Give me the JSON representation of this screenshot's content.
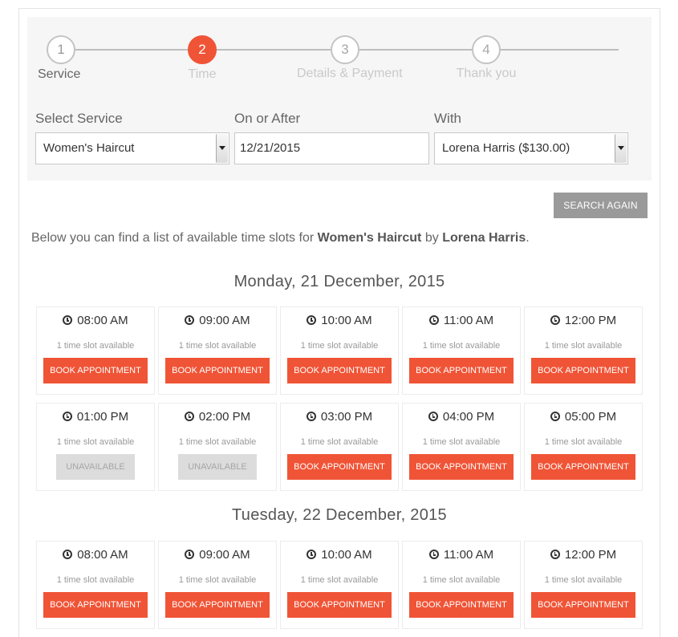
{
  "steps": [
    {
      "number": "1",
      "label": "Service"
    },
    {
      "number": "2",
      "label": "Time"
    },
    {
      "number": "3",
      "label": "Details & Payment"
    },
    {
      "number": "4",
      "label": "Thank you"
    }
  ],
  "form": {
    "service_label": "Select Service",
    "service_value": "Women's Haircut",
    "date_label": "On or After",
    "date_value": "12/21/2015",
    "staff_label": "With",
    "staff_value": "Lorena Harris ($130.00)"
  },
  "search_again_label": "SEARCH AGAIN",
  "intro": {
    "prefix": "Below you can find a list of available time slots for ",
    "service": "Women's Haircut",
    "middle": " by ",
    "staff": "Lorena Harris",
    "suffix": "."
  },
  "days": [
    {
      "heading": "Monday, 21 December, 2015",
      "slots": [
        {
          "time": "08:00 AM",
          "availability": "1 time slot available",
          "button": "BOOK APPOINTMENT",
          "available": true
        },
        {
          "time": "09:00 AM",
          "availability": "1 time slot available",
          "button": "BOOK APPOINTMENT",
          "available": true
        },
        {
          "time": "10:00 AM",
          "availability": "1 time slot available",
          "button": "BOOK APPOINTMENT",
          "available": true
        },
        {
          "time": "11:00 AM",
          "availability": "1 time slot available",
          "button": "BOOK APPOINTMENT",
          "available": true
        },
        {
          "time": "12:00 PM",
          "availability": "1 time slot available",
          "button": "BOOK APPOINTMENT",
          "available": true
        },
        {
          "time": "01:00 PM",
          "availability": "1 time slot available",
          "button": "UNAVAILABLE",
          "available": false
        },
        {
          "time": "02:00 PM",
          "availability": "1 time slot available",
          "button": "UNAVAILABLE",
          "available": false
        },
        {
          "time": "03:00 PM",
          "availability": "1 time slot available",
          "button": "BOOK APPOINTMENT",
          "available": true
        },
        {
          "time": "04:00 PM",
          "availability": "1 time slot available",
          "button": "BOOK APPOINTMENT",
          "available": true
        },
        {
          "time": "05:00 PM",
          "availability": "1 time slot available",
          "button": "BOOK APPOINTMENT",
          "available": true
        }
      ]
    },
    {
      "heading": "Tuesday, 22 December, 2015",
      "slots": [
        {
          "time": "08:00 AM",
          "availability": "1 time slot available",
          "button": "BOOK APPOINTMENT",
          "available": true
        },
        {
          "time": "09:00 AM",
          "availability": "1 time slot available",
          "button": "BOOK APPOINTMENT",
          "available": true
        },
        {
          "time": "10:00 AM",
          "availability": "1 time slot available",
          "button": "BOOK APPOINTMENT",
          "available": true
        },
        {
          "time": "11:00 AM",
          "availability": "1 time slot available",
          "button": "BOOK APPOINTMENT",
          "available": true
        },
        {
          "time": "12:00 PM",
          "availability": "1 time slot available",
          "button": "BOOK APPOINTMENT",
          "available": true
        }
      ]
    }
  ],
  "colors": {
    "accent": "#f05436",
    "disabled": "#dcdcdc",
    "search_button": "#9a9a9a"
  }
}
